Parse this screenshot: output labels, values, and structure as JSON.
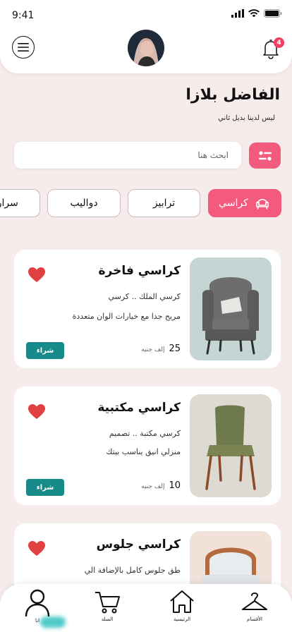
{
  "status": {
    "time": "9:41"
  },
  "header": {
    "notification_count": "4"
  },
  "page": {
    "title": "الفاضل بلازا",
    "subtitle": "ليس لدينا بديل ثاني"
  },
  "search": {
    "placeholder": "ابحث هنا"
  },
  "categories": [
    {
      "label": "كراسي",
      "active": true
    },
    {
      "label": "ترابيز",
      "active": false
    },
    {
      "label": "دواليب",
      "active": false
    },
    {
      "label": "سرارير",
      "active": false
    }
  ],
  "products": [
    {
      "title": "كراسي فاخرة",
      "line1": "كرسي الملك .. كرسي",
      "line2": "مريح جدا مع خيارات الوان متعددة",
      "price": "25",
      "price_unit": "إلف جنيه",
      "buy_label": "شراء"
    },
    {
      "title": "كراسي مكتبية",
      "line1": "كرسي مكتبة .. تصميم",
      "line2": "منزلي انيق يناسب بيتك",
      "price": "10",
      "price_unit": "إلف جنيه",
      "buy_label": "شراء"
    },
    {
      "title": "كراسي جلوس",
      "line1": "طق جلوس كامل بالإضافة الي",
      "line2": "",
      "price": "",
      "price_unit": "",
      "buy_label": ""
    }
  ],
  "bottom_nav": {
    "profile": "انا",
    "cart": "السلة",
    "home": "الرئيسية",
    "categories": "الأقسام"
  },
  "colors": {
    "accent": "#f35b7e",
    "buy": "#178a8a",
    "background": "#f7ecec",
    "heart": "#e0403f"
  }
}
